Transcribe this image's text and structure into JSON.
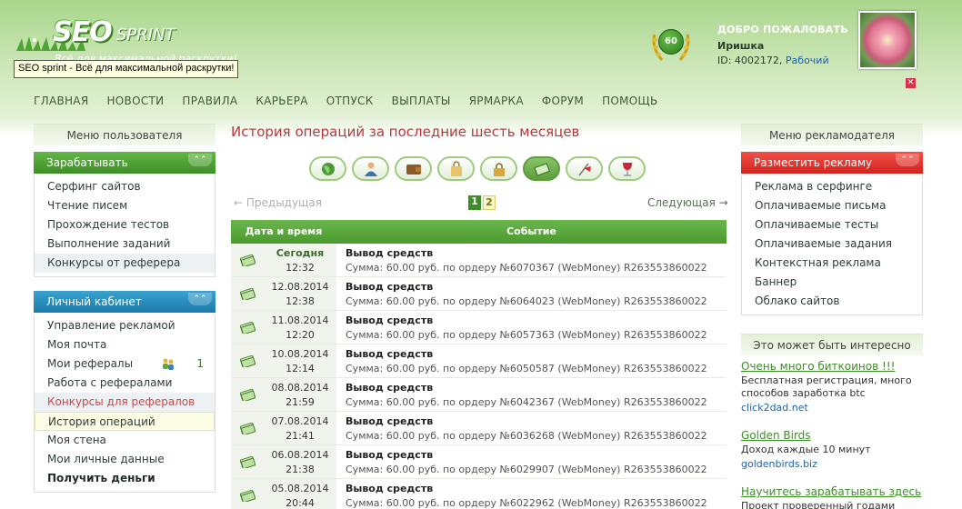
{
  "header": {
    "logo_main": "SEO",
    "logo_sub": "SPRINT",
    "logo_tagline": "Всё для максимальной раскрутки!",
    "tooltip": "SEO sprint - Всё для максимальной раскрутки!",
    "rank": "60",
    "welcome": "ДОБРО ПОЖАЛОВАТЬ",
    "username": "Иришка",
    "id_label": "ID: 4002172,",
    "status": "Рабочий",
    "close": "✕"
  },
  "nav": [
    "ГЛАВНАЯ",
    "НОВОСТИ",
    "ПРАВИЛА",
    "КАРЬЕРА",
    "ОТПУСК",
    "ВЫПЛАТЫ",
    "ЯРМАРКА",
    "ФОРУМ",
    "ПОМОЩЬ"
  ],
  "left": {
    "title": "Меню пользователя",
    "earn": {
      "head": "Зарабатывать",
      "items": [
        "Серфинг сайтов",
        "Чтение писем",
        "Прохождение тестов",
        "Выполнение заданий",
        "Конкурсы от реферера"
      ]
    },
    "cabinet": {
      "head": "Личный кабинет",
      "items": [
        "Управление рекламой",
        "Моя почта",
        "Мои рефералы",
        "Работа с рефералами",
        "Конкурсы для рефералов",
        "История операций",
        "Моя стена",
        "Мои личные данные",
        "Получить деньги"
      ],
      "referrals_count": "1"
    }
  },
  "right": {
    "title": "Меню рекламодателя",
    "head": "Разместить рекламу",
    "items": [
      "Реклама в серфинге",
      "Оплачиваемые письма",
      "Оплачиваемые тесты",
      "Оплачиваемые задания",
      "Контекстная реклама",
      "Баннер",
      "Облако сайтов"
    ],
    "interest_title": "Это может быть интересно",
    "promos": [
      {
        "title": "Очень много биткоинов !!!",
        "desc": "Бесплатная регистрация, много способов заработка btc",
        "url": "click2dad.net"
      },
      {
        "title": "Golden Birds",
        "desc": "Доход каждые 10 минут",
        "url": "goldenbirds.biz"
      },
      {
        "title": "Научитесь зарабатывать здесь",
        "desc": "Проект проверенный годами Супер",
        "url": ""
      }
    ]
  },
  "main": {
    "title": "История операций за последние шесть месяцев",
    "icons": [
      "globe-icon",
      "person-icon",
      "wallet-icon",
      "bag-icon",
      "lock-icon",
      "money-icon",
      "flag-icon",
      "wine-icon"
    ],
    "prev": "← Предыдущая",
    "next": "Следующая →",
    "pages": [
      "1",
      "2"
    ],
    "col_date": "Дата и время",
    "col_event": "Событие",
    "rows": [
      {
        "date": "Сегодня",
        "time": "12:32",
        "title": "Вывод средств",
        "desc": "Сумма: 60.00 руб. по ордеру №6070367 (WebMoney) R263553860022"
      },
      {
        "date": "12.08.2014",
        "time": "12:38",
        "title": "Вывод средств",
        "desc": "Сумма: 60.00 руб. по ордеру №6064023 (WebMoney) R263553860022"
      },
      {
        "date": "11.08.2014",
        "time": "12:20",
        "title": "Вывод средств",
        "desc": "Сумма: 60.00 руб. по ордеру №6057363 (WebMoney) R263553860022"
      },
      {
        "date": "10.08.2014",
        "time": "12:14",
        "title": "Вывод средств",
        "desc": "Сумма: 60.00 руб. по ордеру №6050587 (WebMoney) R263553860022"
      },
      {
        "date": "08.08.2014",
        "time": "21:59",
        "title": "Вывод средств",
        "desc": "Сумма: 60.00 руб. по ордеру №6042367 (WebMoney) R263553860022"
      },
      {
        "date": "07.08.2014",
        "time": "21:41",
        "title": "Вывод средств",
        "desc": "Сумма: 60.00 руб. по ордеру №6036268 (WebMoney) R263553860022"
      },
      {
        "date": "06.08.2014",
        "time": "21:38",
        "title": "Вывод средств",
        "desc": "Сумма: 60.00 руб. по ордеру №6029907 (WebMoney) R263553860022"
      },
      {
        "date": "05.08.2014",
        "time": "20:44",
        "title": "Вывод средств",
        "desc": "Сумма: 60.00 руб. по ордеру №6022962 (WebMoney) R263553860022"
      }
    ]
  }
}
